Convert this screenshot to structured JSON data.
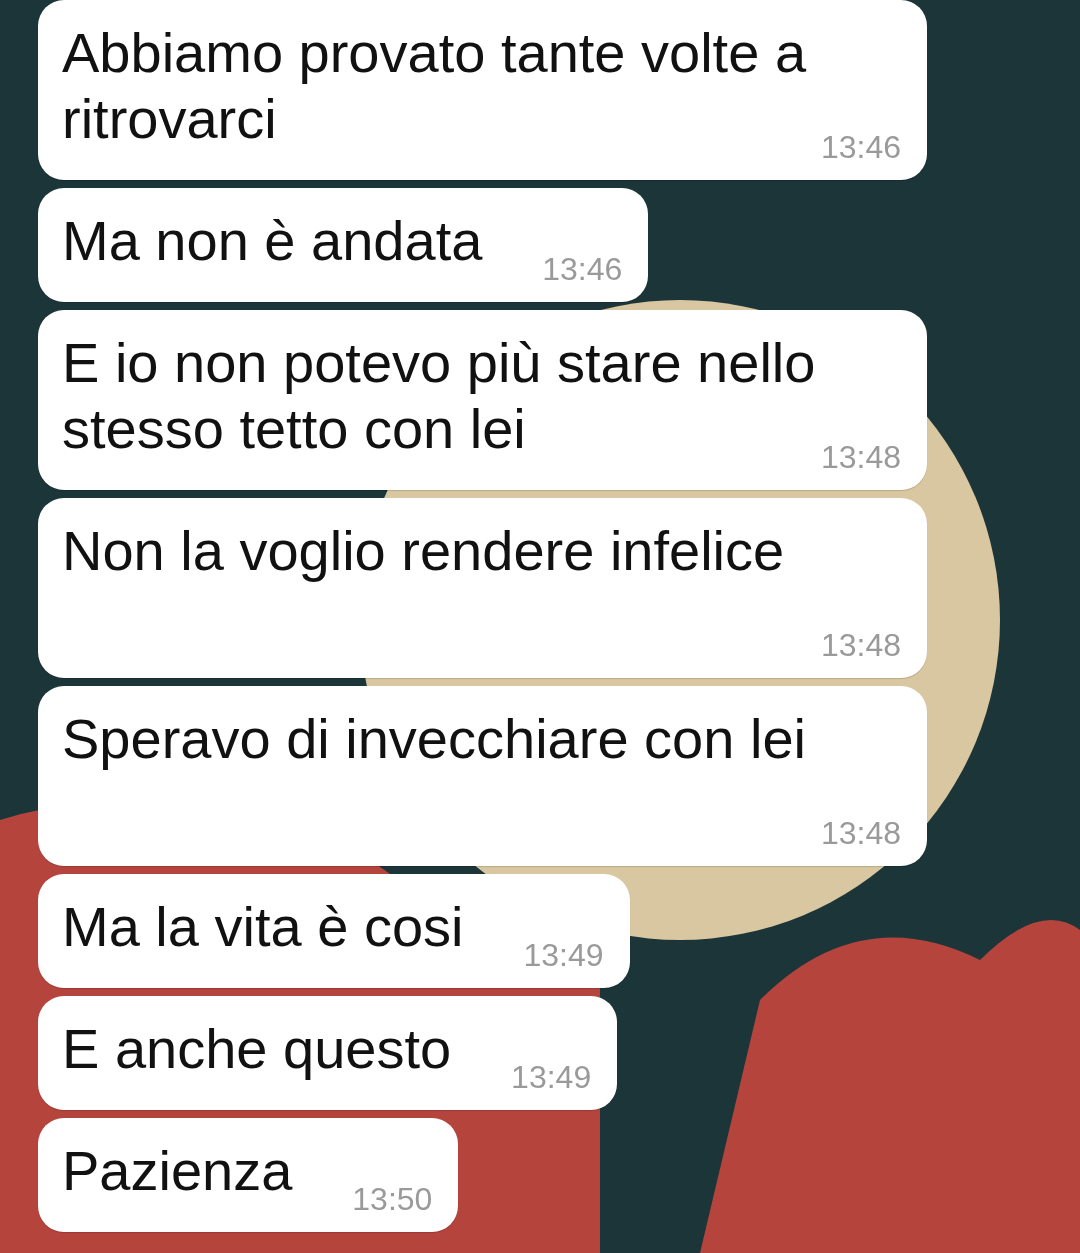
{
  "messages": [
    {
      "text": "Abbiamo provato tante volte a ritrovarci",
      "time": "13:46"
    },
    {
      "text": "Ma non è andata",
      "time": "13:46"
    },
    {
      "text": "E io non potevo più stare nello stesso tetto con lei",
      "time": "13:48"
    },
    {
      "text": "Non la voglio rendere infelice",
      "time": "13:48"
    },
    {
      "text": "Speravo di invecchiare con lei",
      "time": "13:48"
    },
    {
      "text": "Ma la vita è cosi",
      "time": "13:49"
    },
    {
      "text": "E anche questo",
      "time": "13:49"
    },
    {
      "text": "Pazienza",
      "time": "13:50"
    }
  ]
}
